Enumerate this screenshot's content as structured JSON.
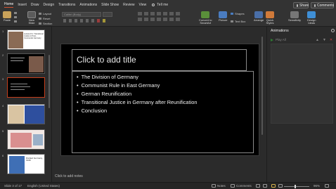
{
  "tabs": [
    "Home",
    "Insert",
    "Draw",
    "Design",
    "Transitions",
    "Animations",
    "Slide Show",
    "Review",
    "View"
  ],
  "active_tab": "Home",
  "tell_me": "Tell me",
  "share": "Share",
  "comments": "Comments",
  "ribbon": {
    "paste": "Paste",
    "new_slide": "New\nSlide",
    "layout": "Layout",
    "reset": "Reset",
    "section": "Section",
    "font_placeholder": "Calibri (Body)",
    "convert_smartart": "Convert to\nSmartArt",
    "picture": "Picture",
    "shapes": "Shapes",
    "text_box": "Text Box",
    "arrange": "Arrange",
    "quick_styles": "Quick\nStyles",
    "sensitivity": "Sensitivity",
    "design_ideas": "Design\nIdeas"
  },
  "thumbnails": {
    "numbers": [
      "1",
      "2",
      "3",
      "4",
      "5",
      "6"
    ],
    "thumb1_title": "Lecture 8.1: Transitional Justice in Post-Communist Germany",
    "thumb6_title": "Divided Germany, 1949"
  },
  "slide": {
    "title_placeholder": "Click to add title",
    "bullets": [
      "The Division of Germany",
      "Communist Rule in East Germany",
      "German Reunification",
      "Transitional Justice in Germany after Reunification",
      "Conclusion"
    ]
  },
  "notes_placeholder": "Click to add notes",
  "animations_pane": {
    "title": "Animations",
    "play_all": "Play All"
  },
  "status": {
    "slide_of": "Slide 3 of 17",
    "language": "English (United States)",
    "notes": "Notes",
    "comments": "Comments",
    "zoom": "96%"
  },
  "colors": {
    "accent": "#c43e1c",
    "ribbon_bg": "#333333",
    "slide_bg": "#000000"
  }
}
